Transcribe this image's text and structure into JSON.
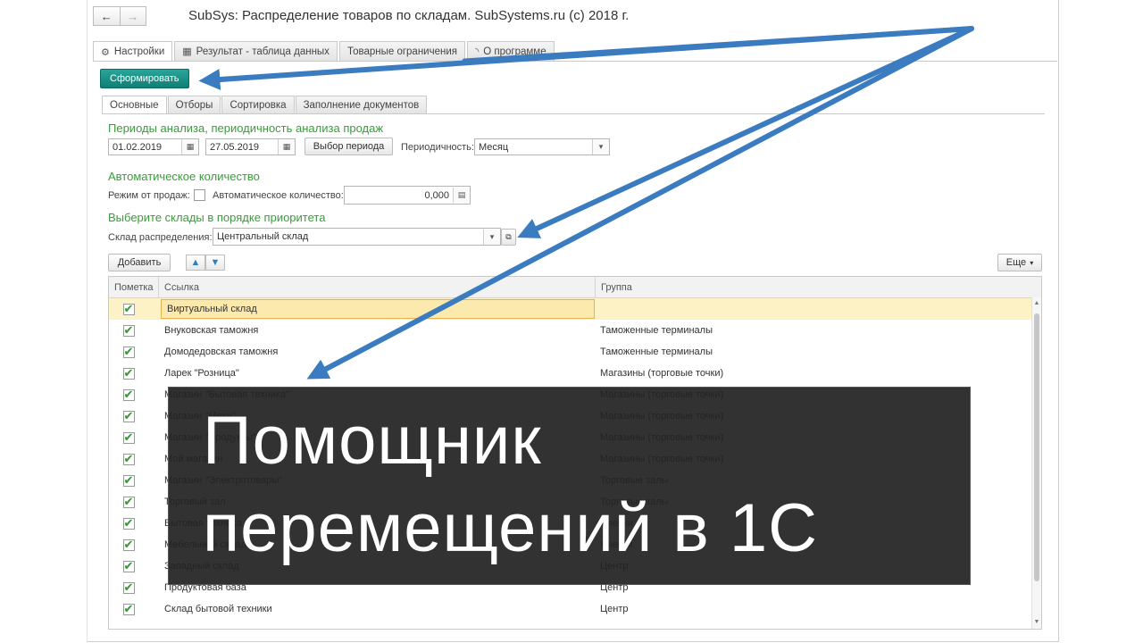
{
  "window": {
    "title": "SubSys: Распределение товаров по складам. SubSystems.ru (c) 2018 г.",
    "nav_back": "←",
    "nav_forward": "→"
  },
  "tabs": [
    {
      "label": "Настройки",
      "icon": "gear-icon",
      "glyph": "⚙"
    },
    {
      "label": "Результат - таблица данных",
      "icon": "table-icon",
      "glyph": "▦"
    },
    {
      "label": "Товарные ограничения",
      "icon": "",
      "glyph": ""
    },
    {
      "label": "О программе",
      "icon": "rss-icon",
      "glyph": "◝"
    }
  ],
  "generate_button": "Сформировать",
  "subtabs": [
    "Основные",
    "Отборы",
    "Сортировка",
    "Заполнение документов"
  ],
  "periods": {
    "heading": "Периоды анализа, периодичность анализа продаж",
    "date_from": "01.02.2019",
    "date_to": "27.05.2019",
    "period_button": "Выбор периода",
    "periodicity_label": "Периодичность:",
    "periodicity_value": "Месяц"
  },
  "auto_qty": {
    "heading": "Автоматическое количество",
    "mode_label": "Режим от продаж:",
    "qty_label": "Автоматическое количество:",
    "qty_value": "0,000"
  },
  "warehouses": {
    "heading": "Выберите склады в порядке приоритета",
    "dist_label": "Склад распределения:",
    "dist_value": "Центральный склад"
  },
  "table_toolbar": {
    "add_button": "Добавить",
    "more_button": "Еще"
  },
  "table": {
    "headers": [
      "Пометка",
      "Ссылка",
      "Группа"
    ],
    "rows": [
      {
        "name": "Виртуальный склад",
        "group": "",
        "checked": true
      },
      {
        "name": "Внуковская таможня",
        "group": "Таможенные терминалы",
        "checked": true
      },
      {
        "name": "Домодедовская таможня",
        "group": "Таможенные терминалы",
        "checked": true
      },
      {
        "name": "Ларек \"Розница\"",
        "group": "Магазины (торговые точки)",
        "checked": true
      },
      {
        "name": "Магазин \"Бытовая техника\"",
        "group": "Магазины (торговые точки)",
        "checked": true
      },
      {
        "name": "Магазин \"Мехи\"",
        "group": "Магазины (торговые точки)",
        "checked": true
      },
      {
        "name": "Магазин \"Продукты\"",
        "group": "Магазины (торговые точки)",
        "checked": true
      },
      {
        "name": "Мой магазин",
        "group": "Магазины (торговые точки)",
        "checked": true
      },
      {
        "name": "Магазин \"Электротовары\"",
        "group": "Торговые залы",
        "checked": true
      },
      {
        "name": "Торговый зал",
        "group": "Торговые залы",
        "checked": true
      },
      {
        "name": "Бытовая техника",
        "group": "Ячейки",
        "checked": true
      },
      {
        "name": "Мебельный склад",
        "group": "Ячейки",
        "checked": true
      },
      {
        "name": "Западный склад",
        "group": "Центр",
        "checked": true
      },
      {
        "name": "Продуктовая база",
        "group": "Центр",
        "checked": true
      },
      {
        "name": "Склад бытовой техники",
        "group": "Центр",
        "checked": true
      }
    ]
  },
  "overlay": {
    "line1": "Помощник",
    "line2": "перемещений в 1С"
  },
  "colors": {
    "accent_green": "#3a9b3a",
    "button_teal": "#16897f",
    "arrow_blue": "#3b7bbf",
    "selection": "#fdf2c6"
  }
}
